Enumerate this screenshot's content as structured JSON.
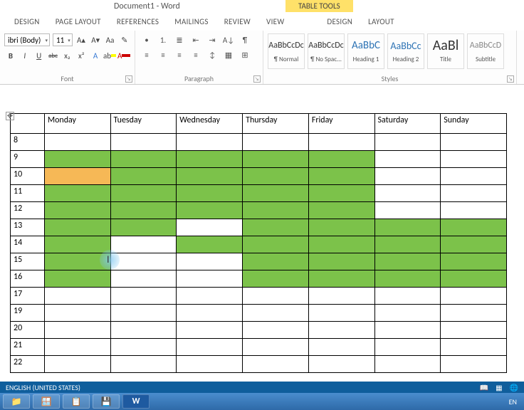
{
  "title": "Document1 - Word",
  "context_tab": "TABLE TOOLS",
  "tabs": [
    "DESIGN",
    "PAGE LAYOUT",
    "REFERENCES",
    "MAILINGS",
    "REVIEW",
    "VIEW",
    "DESIGN",
    "LAYOUT"
  ],
  "font": {
    "name": "ibri (Body)",
    "size": "11",
    "grow": "A▴",
    "shrink": "A▾",
    "case": "Aa",
    "clear": "✎",
    "bold": "B",
    "italic": "I",
    "underline": "U",
    "strike": "abc",
    "sub": "x₂",
    "sup": "x²",
    "effects": "A",
    "highlight": "ab",
    "color": "A",
    "label": "Font"
  },
  "para": {
    "bullets": "•",
    "numbers": "1.",
    "multi": "≣",
    "dec": "⇤",
    "inc": "⇥",
    "sort": "A↓",
    "marks": "¶",
    "left": "≡",
    "center": "≡",
    "right": "≡",
    "just": "≡",
    "spacing": "↕",
    "shade": "▦",
    "borders": "⊞",
    "label": "Paragraph"
  },
  "styles": {
    "items": [
      {
        "preview": "AaBbCcDc",
        "name": "¶ Normal"
      },
      {
        "preview": "AaBbCcDc",
        "name": "¶ No Spac..."
      },
      {
        "preview": "AaBbC",
        "name": "Heading 1"
      },
      {
        "preview": "AaBbCc",
        "name": "Heading 2"
      },
      {
        "preview": "AaBl",
        "name": "Title"
      },
      {
        "preview": "AaBbCcD",
        "name": "Subtitle"
      }
    ],
    "label": "Styles"
  },
  "table": {
    "days": [
      "Monday",
      "Tuesday",
      "Wednesday",
      "Thursday",
      "Friday",
      "Saturday",
      "Sunday"
    ],
    "hours": [
      "8",
      "9",
      "10",
      "11",
      "12",
      "13",
      "14",
      "15",
      "16",
      "17",
      "19",
      "20",
      "21",
      "22"
    ],
    "cells": {
      "9": [
        "green",
        "green",
        "green",
        "green",
        "green",
        "",
        ""
      ],
      "10": [
        "orange",
        "green",
        "green",
        "green",
        "green",
        "",
        ""
      ],
      "11": [
        "green",
        "green",
        "green",
        "green",
        "green",
        "",
        ""
      ],
      "12": [
        "green",
        "green",
        "green",
        "green",
        "green",
        "",
        ""
      ],
      "13": [
        "green",
        "green",
        "",
        "green",
        "green",
        "green",
        "green"
      ],
      "14": [
        "green",
        "",
        "green",
        "green",
        "green",
        "green",
        "green"
      ],
      "15": [
        "green",
        "",
        "",
        "green",
        "green",
        "green",
        "green"
      ],
      "16": [
        "green",
        "",
        "",
        "green",
        "green",
        "green",
        "green"
      ]
    }
  },
  "status": {
    "lang": "ENGLISH (UNITED STATES)",
    "en": "EN"
  },
  "taskbar": {
    "explorer": "📁",
    "app2": "🪟",
    "app3": "📋",
    "save": "💾",
    "word": "W"
  }
}
